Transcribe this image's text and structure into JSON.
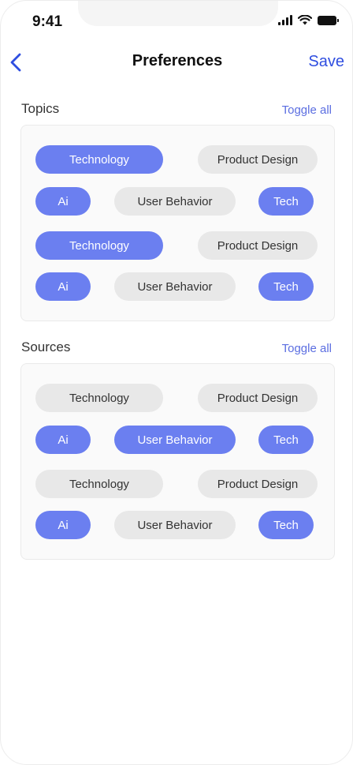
{
  "status_bar": {
    "time": "9:41"
  },
  "nav": {
    "title": "Preferences",
    "save_label": "Save"
  },
  "colors": {
    "accent": "#2f4ee0",
    "chip_on": "#6b7ff0",
    "chip_off": "#e8e8e8"
  },
  "topics": {
    "title": "Topics",
    "toggle_label": "Toggle all",
    "chips": [
      {
        "label": "Technology",
        "selected": true
      },
      {
        "label": "Product Design",
        "selected": false
      },
      {
        "label": "Ai",
        "selected": true
      },
      {
        "label": "User Behavior",
        "selected": false
      },
      {
        "label": "Tech",
        "selected": true
      },
      {
        "label": "Technology",
        "selected": true
      },
      {
        "label": "Product Design",
        "selected": false
      },
      {
        "label": "Ai",
        "selected": true
      },
      {
        "label": "User Behavior",
        "selected": false
      },
      {
        "label": "Tech",
        "selected": true
      }
    ]
  },
  "sources": {
    "title": "Sources",
    "toggle_label": "Toggle all",
    "chips": [
      {
        "label": "Technology",
        "selected": false
      },
      {
        "label": "Product Design",
        "selected": false
      },
      {
        "label": "Ai",
        "selected": true
      },
      {
        "label": "User Behavior",
        "selected": true
      },
      {
        "label": "Tech",
        "selected": true
      },
      {
        "label": "Technology",
        "selected": false
      },
      {
        "label": "Product Design",
        "selected": false
      },
      {
        "label": "Ai",
        "selected": true
      },
      {
        "label": "User Behavior",
        "selected": false
      },
      {
        "label": "Tech",
        "selected": true
      }
    ]
  }
}
